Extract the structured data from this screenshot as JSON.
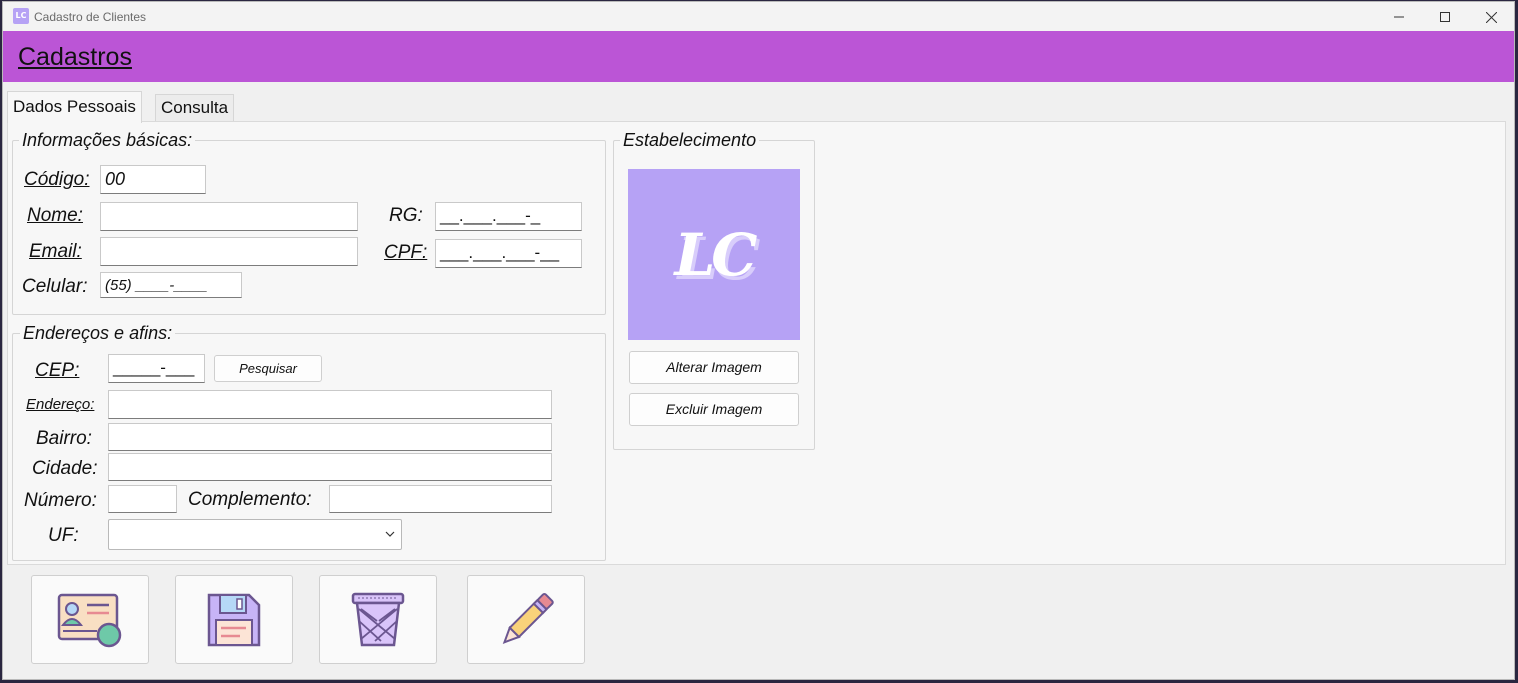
{
  "window": {
    "title": "Cadastro de Clientes",
    "app_icon": "LC"
  },
  "header": {
    "title": "Cadastros"
  },
  "tabs": [
    {
      "label": "Dados Pessoais"
    },
    {
      "label": "Consulta"
    }
  ],
  "basic_info": {
    "legend": "Informações básicas:",
    "codigo_label": "Código:",
    "codigo_value": "00",
    "nome_label": "Nome:",
    "nome_value": "",
    "email_label": "Email:",
    "email_value": "",
    "celular_label": "Celular:",
    "celular_mask": "(55) ____-____",
    "rg_label": "RG:",
    "rg_mask": "__.___.___-_",
    "cpf_label": "CPF:",
    "cpf_mask": "___.___.___-__"
  },
  "address": {
    "legend": "Endereços e afins:",
    "cep_label": "CEP:",
    "cep_mask": "_____-___",
    "search_button": "Pesquisar",
    "endereco_label": "Endereço:",
    "bairro_label": "Bairro:",
    "cidade_label": "Cidade:",
    "numero_label": "Número:",
    "complemento_label": "Complemento:",
    "uf_label": "UF:",
    "uf_value": ""
  },
  "establishment": {
    "legend": "Estabelecimento",
    "logo_text": "LC",
    "change_image_button": "Alterar Imagem",
    "delete_image_button": "Excluir Imagem"
  },
  "actions": [
    {
      "icon": "id-card-icon"
    },
    {
      "icon": "floppy-disk-icon"
    },
    {
      "icon": "trash-can-icon"
    },
    {
      "icon": "pencil-icon"
    }
  ],
  "colors": {
    "header": "#bb55d6",
    "logo_bg": "#b6a2f5"
  }
}
